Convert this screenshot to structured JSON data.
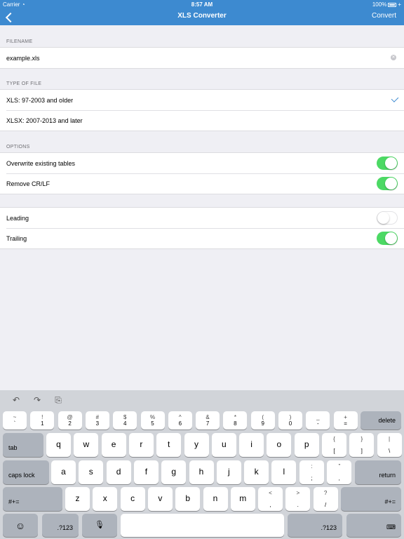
{
  "status": {
    "carrier": "Carrier",
    "time": "8:57 AM",
    "battery": "100%"
  },
  "nav": {
    "title": "XLS Converter",
    "convert": "Convert"
  },
  "sections": {
    "filename_header": "FILENAME",
    "type_header": "TYPE OF FILE",
    "options_header": "OPTIONS"
  },
  "filename": {
    "value": "example.xls"
  },
  "file_types": [
    {
      "label": "XLS: 97-2003 and older",
      "selected": true
    },
    {
      "label": "XLSX: 2007-2013 and later",
      "selected": false
    }
  ],
  "options": [
    {
      "label": "Overwrite existing tables",
      "on": true
    },
    {
      "label": "Remove CR/LF",
      "on": true
    }
  ],
  "trim": [
    {
      "label": "Leading",
      "on": false
    },
    {
      "label": "Trailing",
      "on": true
    }
  ],
  "keyboard": {
    "row1": [
      {
        "top": "~",
        "bottom": "`"
      },
      {
        "top": "!",
        "bottom": "1"
      },
      {
        "top": "@",
        "bottom": "2"
      },
      {
        "top": "#",
        "bottom": "3"
      },
      {
        "top": "$",
        "bottom": "4"
      },
      {
        "top": "%",
        "bottom": "5"
      },
      {
        "top": "^",
        "bottom": "6"
      },
      {
        "top": "&",
        "bottom": "7"
      },
      {
        "top": "*",
        "bottom": "8"
      },
      {
        "top": "(",
        "bottom": "9"
      },
      {
        "top": ")",
        "bottom": "0"
      },
      {
        "top": "_",
        "bottom": "-"
      },
      {
        "top": "+",
        "bottom": "="
      }
    ],
    "delete": "delete",
    "tab": "tab",
    "row2": [
      "q",
      "w",
      "e",
      "r",
      "t",
      "y",
      "u",
      "i",
      "o",
      "p"
    ],
    "row2_punct": [
      {
        "top": "{",
        "bottom": "["
      },
      {
        "top": "}",
        "bottom": "]"
      },
      {
        "top": "|",
        "bottom": "\\"
      }
    ],
    "caps": "caps lock",
    "row3": [
      "a",
      "s",
      "d",
      "f",
      "g",
      "h",
      "j",
      "k",
      "l"
    ],
    "row3_punct": [
      {
        "top": ":",
        "bottom": ";"
      },
      {
        "top": "”",
        "bottom": "‚"
      }
    ],
    "return": "return",
    "shift_left": "#+=",
    "row4": [
      "z",
      "x",
      "c",
      "v",
      "b",
      "n",
      "m"
    ],
    "row4_punct": [
      {
        "top": "<",
        "bottom": ","
      },
      {
        "top": ">",
        "bottom": "."
      },
      {
        "top": "?",
        "bottom": "/"
      }
    ],
    "shift_right": "#+=",
    "num_left": ".?123",
    "num_right": ".?123",
    "emoji": "☺",
    "dictation": "🎙",
    "hide": "⌨"
  }
}
